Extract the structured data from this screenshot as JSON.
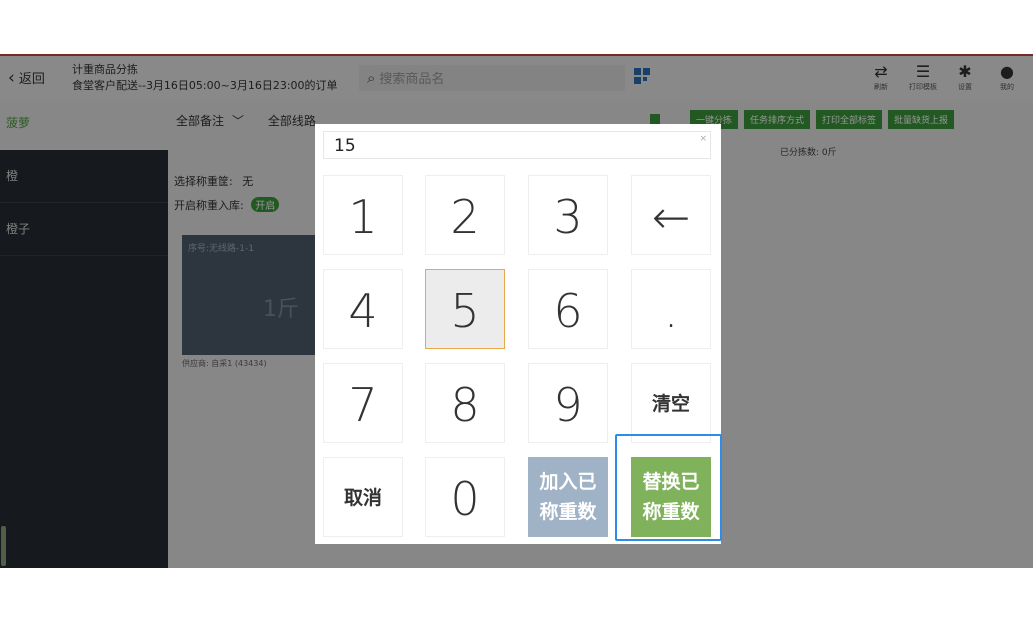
{
  "topbar": {
    "back_label": "返回",
    "title_line1": "计重商品分拣",
    "title_line2": "食堂客户配送--3月16日05:00~3月16日23:00的订单",
    "search_placeholder": "搜索商品名",
    "tools": [
      {
        "icon": "refresh-icon",
        "label": "刷新"
      },
      {
        "icon": "print-template-icon",
        "label": "打印模板"
      },
      {
        "icon": "gear-icon",
        "label": "设置"
      },
      {
        "icon": "user-icon",
        "label": "我的"
      }
    ]
  },
  "sidebar": {
    "current": "菠萝",
    "items": [
      "橙",
      "橙子"
    ]
  },
  "filters": {
    "remark": "全部备注",
    "route": "全部线路"
  },
  "actions": [
    "一键分拣",
    "任务排序方式",
    "打印全部标签",
    "批量缺货上报"
  ],
  "info": {
    "select_basket_label": "选择称重筐:",
    "select_basket_value": "无",
    "weigh_in_label": "开启称重入库:",
    "weigh_in_state": "开启",
    "sorted_text": "已分拣数: 0斤"
  },
  "card": {
    "seq": "序号:无线路-1-1",
    "weight": "1斤",
    "supplier": "供应商: 自采1 (43434)"
  },
  "keypad": {
    "display_value": "15",
    "close": "×",
    "keys": [
      {
        "label": "1",
        "kind": "num"
      },
      {
        "label": "2",
        "kind": "num"
      },
      {
        "label": "3",
        "kind": "num"
      },
      {
        "label": "←",
        "kind": "num"
      },
      {
        "label": "4",
        "kind": "num"
      },
      {
        "label": "5",
        "kind": "num",
        "active": true
      },
      {
        "label": "6",
        "kind": "num"
      },
      {
        "label": ".",
        "kind": "num"
      },
      {
        "label": "7",
        "kind": "num"
      },
      {
        "label": "8",
        "kind": "num"
      },
      {
        "label": "9",
        "kind": "num"
      },
      {
        "label": "清空",
        "kind": "txt"
      },
      {
        "label": "取消",
        "kind": "txt"
      },
      {
        "label": "0",
        "kind": "num"
      },
      {
        "label": "加入已\n称重数",
        "kind": "add"
      },
      {
        "label": "替换已\n称重数",
        "kind": "rep"
      }
    ]
  }
}
